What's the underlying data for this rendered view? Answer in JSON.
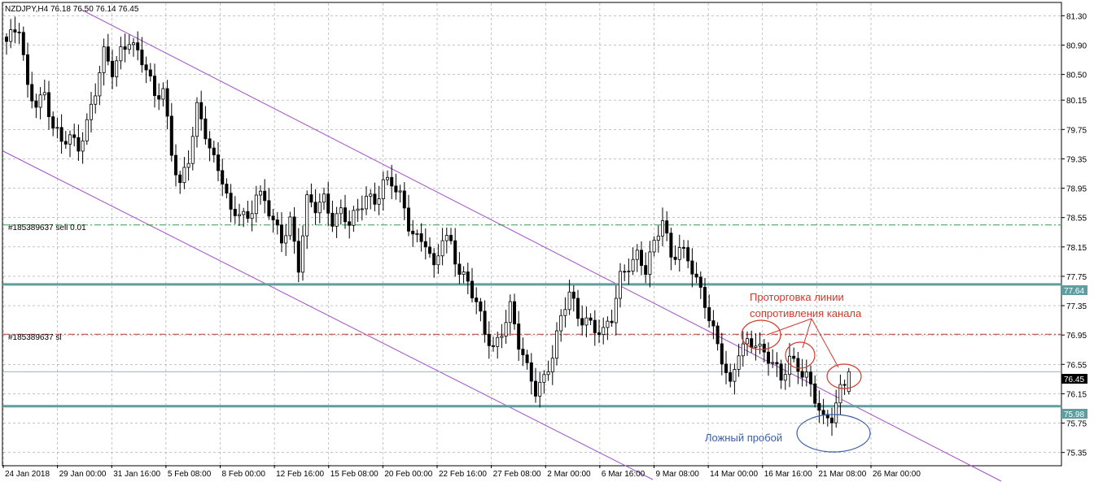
{
  "chart_data": {
    "type": "candlestick",
    "header": "NZDJPY,H4  76.18 76.50 76.14 76.45",
    "symbol": "NZDJPY",
    "timeframe": "H4",
    "ohlc_last": {
      "open": 76.18,
      "high": 76.5,
      "low": 76.14,
      "close": 76.45
    },
    "y_ticks": [
      "81.30",
      "80.90",
      "80.50",
      "80.15",
      "79.75",
      "79.35",
      "78.95",
      "78.55",
      "78.15",
      "77.75",
      "77.35",
      "76.95",
      "76.55",
      "76.15",
      "75.75",
      "75.35"
    ],
    "x_ticks": [
      "24 Jan 2018",
      "29 Jan 00:00",
      "31 Jan 16:00",
      "5 Feb 08:00",
      "8 Feb 00:00",
      "12 Feb 16:00",
      "15 Feb 08:00",
      "20 Feb 00:00",
      "22 Feb 16:00",
      "27 Feb 08:00",
      "2 Mar 00:00",
      "6 Mar 16:00",
      "9 Mar 08:00",
      "14 Mar 00:00",
      "16 Mar 16:00",
      "21 Mar 08:00",
      "26 Mar 00:00"
    ],
    "ylim": [
      75.18,
      81.47
    ],
    "grid": true,
    "price_labels": {
      "resistance": "77.64",
      "support": "75.98",
      "current": "76.45"
    },
    "levels": [
      {
        "label": "#185389637 sell 0.01",
        "price": 78.45,
        "color": "#2ea043",
        "style": "dashdot"
      },
      {
        "label": "#185389637 sl",
        "price": 76.96,
        "color": "#b23a2a",
        "style": "dashdot"
      }
    ],
    "horizontal_lines": [
      77.64,
      75.98
    ],
    "annotations": {
      "red": [
        "Проторговка линии",
        "сопротивления канала"
      ],
      "blue": "Ложный пробой"
    },
    "anchors": [
      [
        0,
        80.95
      ],
      [
        3,
        81.1
      ],
      [
        5,
        80.3
      ],
      [
        7,
        80.15
      ],
      [
        9,
        80.25
      ],
      [
        11,
        79.75
      ],
      [
        13,
        79.55
      ],
      [
        15,
        79.65
      ],
      [
        17,
        79.55
      ],
      [
        19,
        79.85
      ],
      [
        21,
        80.25
      ],
      [
        23,
        80.75
      ],
      [
        25,
        80.55
      ],
      [
        27,
        80.85
      ],
      [
        29,
        81.0
      ],
      [
        31,
        80.75
      ],
      [
        33,
        80.55
      ],
      [
        35,
        80.2
      ],
      [
        37,
        80.35
      ],
      [
        39,
        79.45
      ],
      [
        41,
        78.95
      ],
      [
        43,
        79.3
      ],
      [
        45,
        80.05
      ],
      [
        47,
        79.75
      ],
      [
        49,
        79.35
      ],
      [
        51,
        79.05
      ],
      [
        53,
        78.55
      ],
      [
        55,
        78.65
      ],
      [
        57,
        78.55
      ],
      [
        59,
        78.9
      ],
      [
        61,
        78.75
      ],
      [
        63,
        78.45
      ],
      [
        65,
        78.25
      ],
      [
        67,
        78.55
      ],
      [
        69,
        77.9
      ],
      [
        71,
        78.75
      ],
      [
        73,
        78.65
      ],
      [
        75,
        78.8
      ],
      [
        77,
        78.55
      ],
      [
        79,
        78.65
      ],
      [
        81,
        78.45
      ],
      [
        83,
        78.6
      ],
      [
        85,
        78.85
      ],
      [
        87,
        78.8
      ],
      [
        89,
        79.05
      ],
      [
        91,
        79.0
      ],
      [
        93,
        78.8
      ],
      [
        95,
        78.45
      ],
      [
        97,
        78.3
      ],
      [
        99,
        78.25
      ],
      [
        101,
        77.8
      ],
      [
        103,
        78.25
      ],
      [
        105,
        78.2
      ],
      [
        107,
        77.85
      ],
      [
        109,
        77.7
      ],
      [
        111,
        77.35
      ],
      [
        113,
        76.95
      ],
      [
        115,
        76.75
      ],
      [
        117,
        77.05
      ],
      [
        119,
        77.35
      ],
      [
        121,
        76.8
      ],
      [
        123,
        76.45
      ],
      [
        125,
        76.2
      ],
      [
        127,
        76.4
      ],
      [
        129,
        76.7
      ],
      [
        131,
        77.15
      ],
      [
        133,
        77.5
      ],
      [
        135,
        77.2
      ],
      [
        137,
        77.2
      ],
      [
        139,
        77.05
      ],
      [
        141,
        76.95
      ],
      [
        143,
        77.15
      ],
      [
        145,
        77.75
      ],
      [
        147,
        77.95
      ],
      [
        149,
        78.05
      ],
      [
        151,
        77.8
      ],
      [
        153,
        78.15
      ],
      [
        155,
        78.55
      ],
      [
        157,
        78.05
      ],
      [
        159,
        78.15
      ],
      [
        161,
        77.95
      ],
      [
        163,
        77.65
      ],
      [
        165,
        77.4
      ],
      [
        167,
        77.05
      ],
      [
        169,
        76.65
      ],
      [
        171,
        76.2
      ],
      [
        173,
        76.7
      ],
      [
        175,
        76.85
      ],
      [
        177,
        76.9
      ],
      [
        179,
        76.7
      ],
      [
        181,
        76.55
      ],
      [
        183,
        76.3
      ],
      [
        185,
        76.65
      ],
      [
        187,
        76.55
      ],
      [
        189,
        76.4
      ],
      [
        191,
        76.05
      ],
      [
        193,
        75.75
      ],
      [
        195,
        75.85
      ],
      [
        197,
        76.25
      ],
      [
        199,
        76.45
      ]
    ]
  }
}
